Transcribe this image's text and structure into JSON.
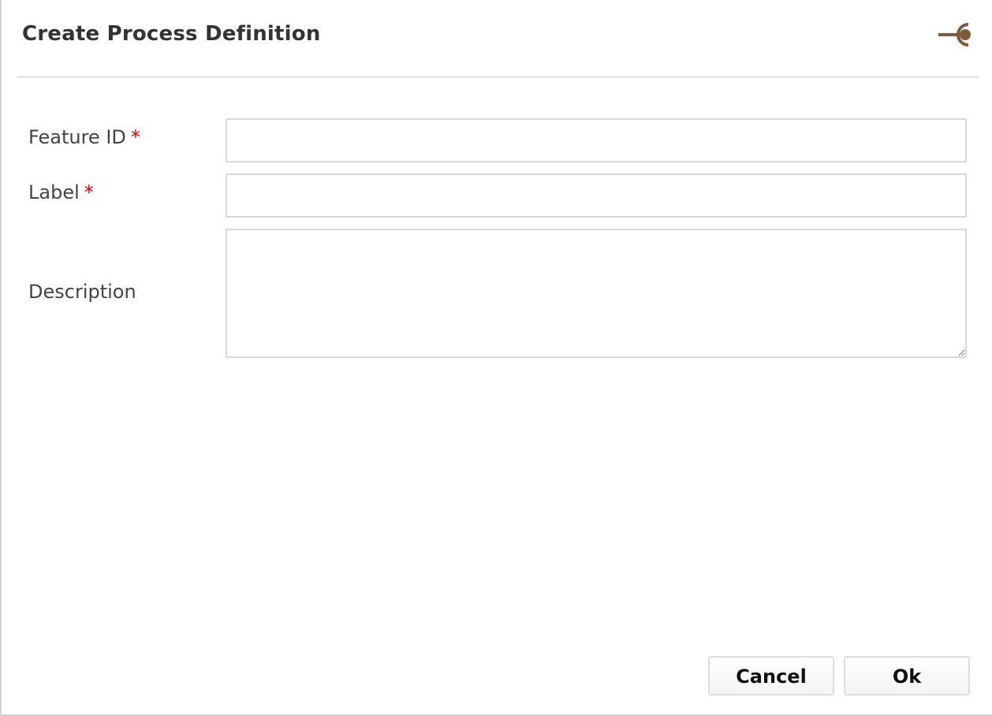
{
  "dialog": {
    "title": "Create Process Definition",
    "pin_icon": "pin-icon"
  },
  "form": {
    "feature_id": {
      "label": "Feature ID",
      "required_marker": "*",
      "value": "",
      "placeholder": ""
    },
    "label": {
      "label": "Label",
      "required_marker": "*",
      "value": "",
      "placeholder": ""
    },
    "description": {
      "label": "Description",
      "value": "",
      "placeholder": ""
    }
  },
  "buttons": {
    "cancel_label": "Cancel",
    "ok_label": "Ok"
  },
  "colors": {
    "accent_icon": "#7a5c3a",
    "required": "#e00000"
  }
}
